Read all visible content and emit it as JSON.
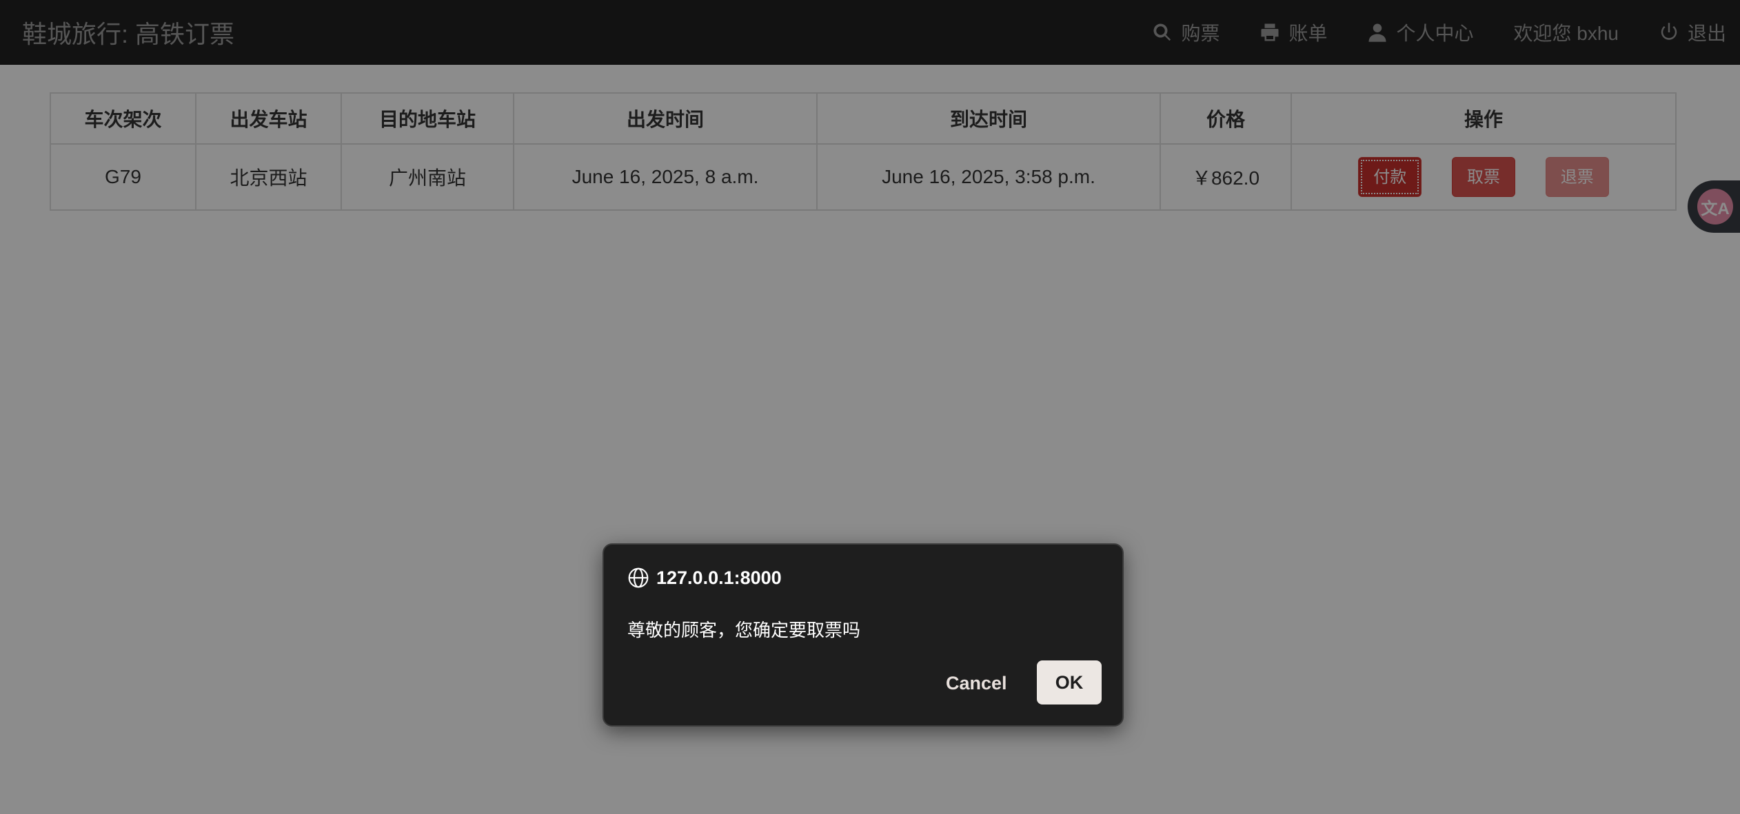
{
  "navbar": {
    "brand": "鞋城旅行: 高铁订票",
    "items": [
      {
        "label": "购票",
        "icon": "search-icon"
      },
      {
        "label": "账单",
        "icon": "print-icon"
      },
      {
        "label": "个人中心",
        "icon": "user-icon"
      },
      {
        "label": "欢迎您 bxhu"
      },
      {
        "label": "退出",
        "icon": "power-icon"
      }
    ]
  },
  "table": {
    "headers": [
      "车次架次",
      "出发车站",
      "目的地车站",
      "出发时间",
      "到达时间",
      "价格",
      "操作"
    ],
    "rows": [
      {
        "train": "G79",
        "from": "北京西站",
        "to": "广州南站",
        "depart": "June 16, 2025, 8 a.m.",
        "arrive": "June 16, 2025, 3:58 p.m.",
        "price": "￥862.0",
        "actions": {
          "pay": "付款",
          "cancel": "取票",
          "refund": "退票"
        }
      }
    ]
  },
  "translate_widget": {
    "glyph": "文A"
  },
  "dialog": {
    "origin": "127.0.0.1:8000",
    "message": "尊敬的顾客，您确定要取票吗",
    "cancel_label": "Cancel",
    "ok_label": "OK"
  },
  "colors": {
    "navbar_bg": "#222222",
    "danger": "#d9534f",
    "dialog_bg": "#1e1e1e"
  }
}
